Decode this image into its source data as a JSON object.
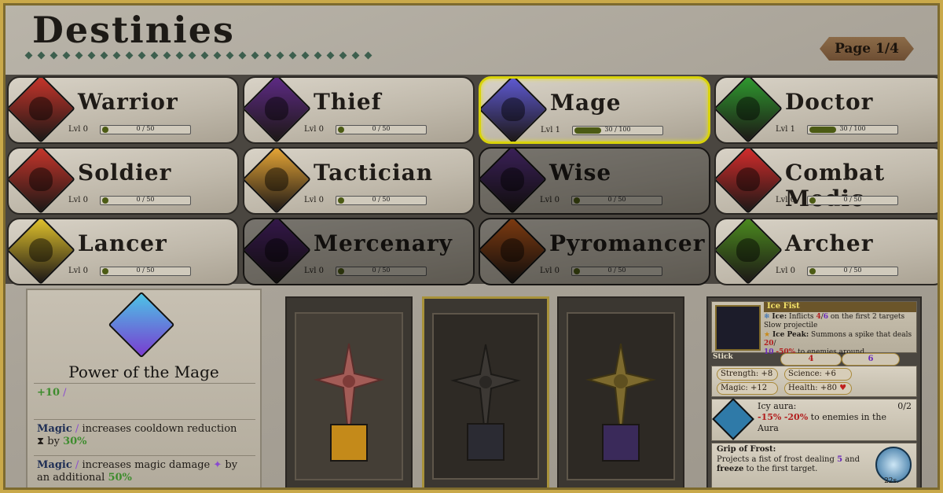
{
  "title": "Destinies",
  "page_label": "Page 1/4",
  "destinies": [
    {
      "name": "Warrior",
      "lvl": "Lvl 0",
      "progress": "0 / 50",
      "fill": 0,
      "color": "#c8352b",
      "dim": false,
      "selected": false
    },
    {
      "name": "Thief",
      "lvl": "Lvl 0",
      "progress": "0 / 50",
      "fill": 0,
      "color": "#5e2a86",
      "dim": false,
      "selected": false
    },
    {
      "name": "Mage",
      "lvl": "Lvl 1",
      "progress": "30 / 100",
      "fill": 0.3,
      "color": "#5f5ad4",
      "dim": false,
      "selected": true
    },
    {
      "name": "Doctor",
      "lvl": "Lvl 1",
      "progress": "30 / 100",
      "fill": 0.3,
      "color": "#2f9b2f",
      "dim": false,
      "selected": false
    },
    {
      "name": "Soldier",
      "lvl": "Lvl 0",
      "progress": "0 / 50",
      "fill": 0,
      "color": "#c8352b",
      "dim": false,
      "selected": false
    },
    {
      "name": "Tactician",
      "lvl": "Lvl 0",
      "progress": "0 / 50",
      "fill": 0,
      "color": "#e8a736",
      "dim": false,
      "selected": false
    },
    {
      "name": "Wise",
      "lvl": "Lvl 0",
      "progress": "0 / 50",
      "fill": 0,
      "color": "#6a3aa0",
      "dim": true,
      "selected": false
    },
    {
      "name": "Combat Medic",
      "lvl": "Lvl 0",
      "progress": "0 / 50",
      "fill": 0,
      "color": "#d52c2c",
      "dim": false,
      "selected": false
    },
    {
      "name": "Lancer",
      "lvl": "Lvl 0",
      "progress": "0 / 50",
      "fill": 0,
      "color": "#e3c42c",
      "dim": false,
      "selected": false
    },
    {
      "name": "Mercenary",
      "lvl": "Lvl 0",
      "progress": "0 / 50",
      "fill": 0,
      "color": "#5e2a86",
      "dim": true,
      "selected": false
    },
    {
      "name": "Pyromancer",
      "lvl": "Lvl 0",
      "progress": "0 / 50",
      "fill": 0,
      "color": "#e56a1e",
      "dim": true,
      "selected": false
    },
    {
      "name": "Archer",
      "lvl": "Lvl 0",
      "progress": "0 / 50",
      "fill": 0,
      "color": "#4c8c1f",
      "dim": false,
      "selected": false
    }
  ],
  "power": {
    "title": "Power of the Mage",
    "bonus": "+10",
    "row1_a": "Magic",
    "row1_b": "increases cooldown reduction",
    "row1_c": "by",
    "row1_val": "30%",
    "row2_a": "Magic",
    "row2_b": "increases magic damage",
    "row2_c": "by",
    "row2_d": "an additional",
    "row2_val": "50%"
  },
  "detail": {
    "weapon_name": "Ice Fist",
    "ice_label": "Ice:",
    "ice_text": "Inflicts",
    "ice_a": "4",
    "ice_sep": "/",
    "ice_b": "6",
    "ice_tail": "on the first 2 targets",
    "slow": "Slow projectile",
    "peak_label": "Ice Peak:",
    "peak_text": "Summons a spike that deals",
    "peak_a": "20",
    "peak_sep": "/",
    "peak_b": "10",
    "peak_c": "-50%",
    "peak_tail": "to enemies around.",
    "stick_label": "Stick",
    "stick_a": "4",
    "stick_b": "6",
    "strength_label": "Strength:",
    "strength_val": "+8",
    "science_label": "Science:",
    "science_val": "+6",
    "magic_label": "Magic:",
    "magic_val": "+12",
    "health_label": "Health:",
    "health_val": "+80",
    "aura_title": "Icy aura:",
    "aura_count": "0/2",
    "aura_a": "-15%",
    "aura_b": "-20%",
    "aura_tail": "to enemies in the",
    "aura_word": "Aura",
    "grip_title": "Grip of Frost:",
    "grip_text1": "Projects a fist of frost dealing",
    "grip_val": "5",
    "grip_text2": "and",
    "grip_freeze": "freeze",
    "grip_text3": "to the first target.",
    "grip_cd": "22s."
  }
}
